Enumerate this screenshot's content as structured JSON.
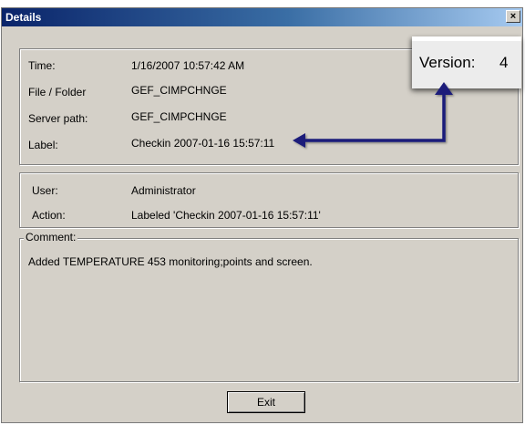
{
  "window": {
    "title": "Details",
    "close_glyph": "×"
  },
  "info": {
    "time_label": "Time:",
    "time_value": "1/16/2007 10:57:42 AM",
    "file_label": "File / Folder",
    "file_value": "GEF_CIMPCHNGE",
    "server_label": "Server path:",
    "server_value": "GEF_CIMPCHNGE",
    "label_label": "Label:",
    "label_value": "Checkin 2007-01-16 15:57:11"
  },
  "user_info": {
    "user_label": "User:",
    "user_value": "Administrator",
    "action_label": "Action:",
    "action_value": "Labeled 'Checkin 2007-01-16 15:57:11'"
  },
  "comment": {
    "legend": "Comment:",
    "text": "Added TEMPERATURE 453 monitoring;points and screen."
  },
  "buttons": {
    "exit_label": "Exit"
  },
  "callout": {
    "version_label": "Version:",
    "version_value": "4"
  },
  "colors": {
    "titlebar_start": "#0a246a",
    "dialog_bg": "#d4d0c8",
    "arrow": "#1c1f7a"
  },
  "icons": {
    "close": "close-icon",
    "arrow": "annotation-arrow-icon"
  }
}
